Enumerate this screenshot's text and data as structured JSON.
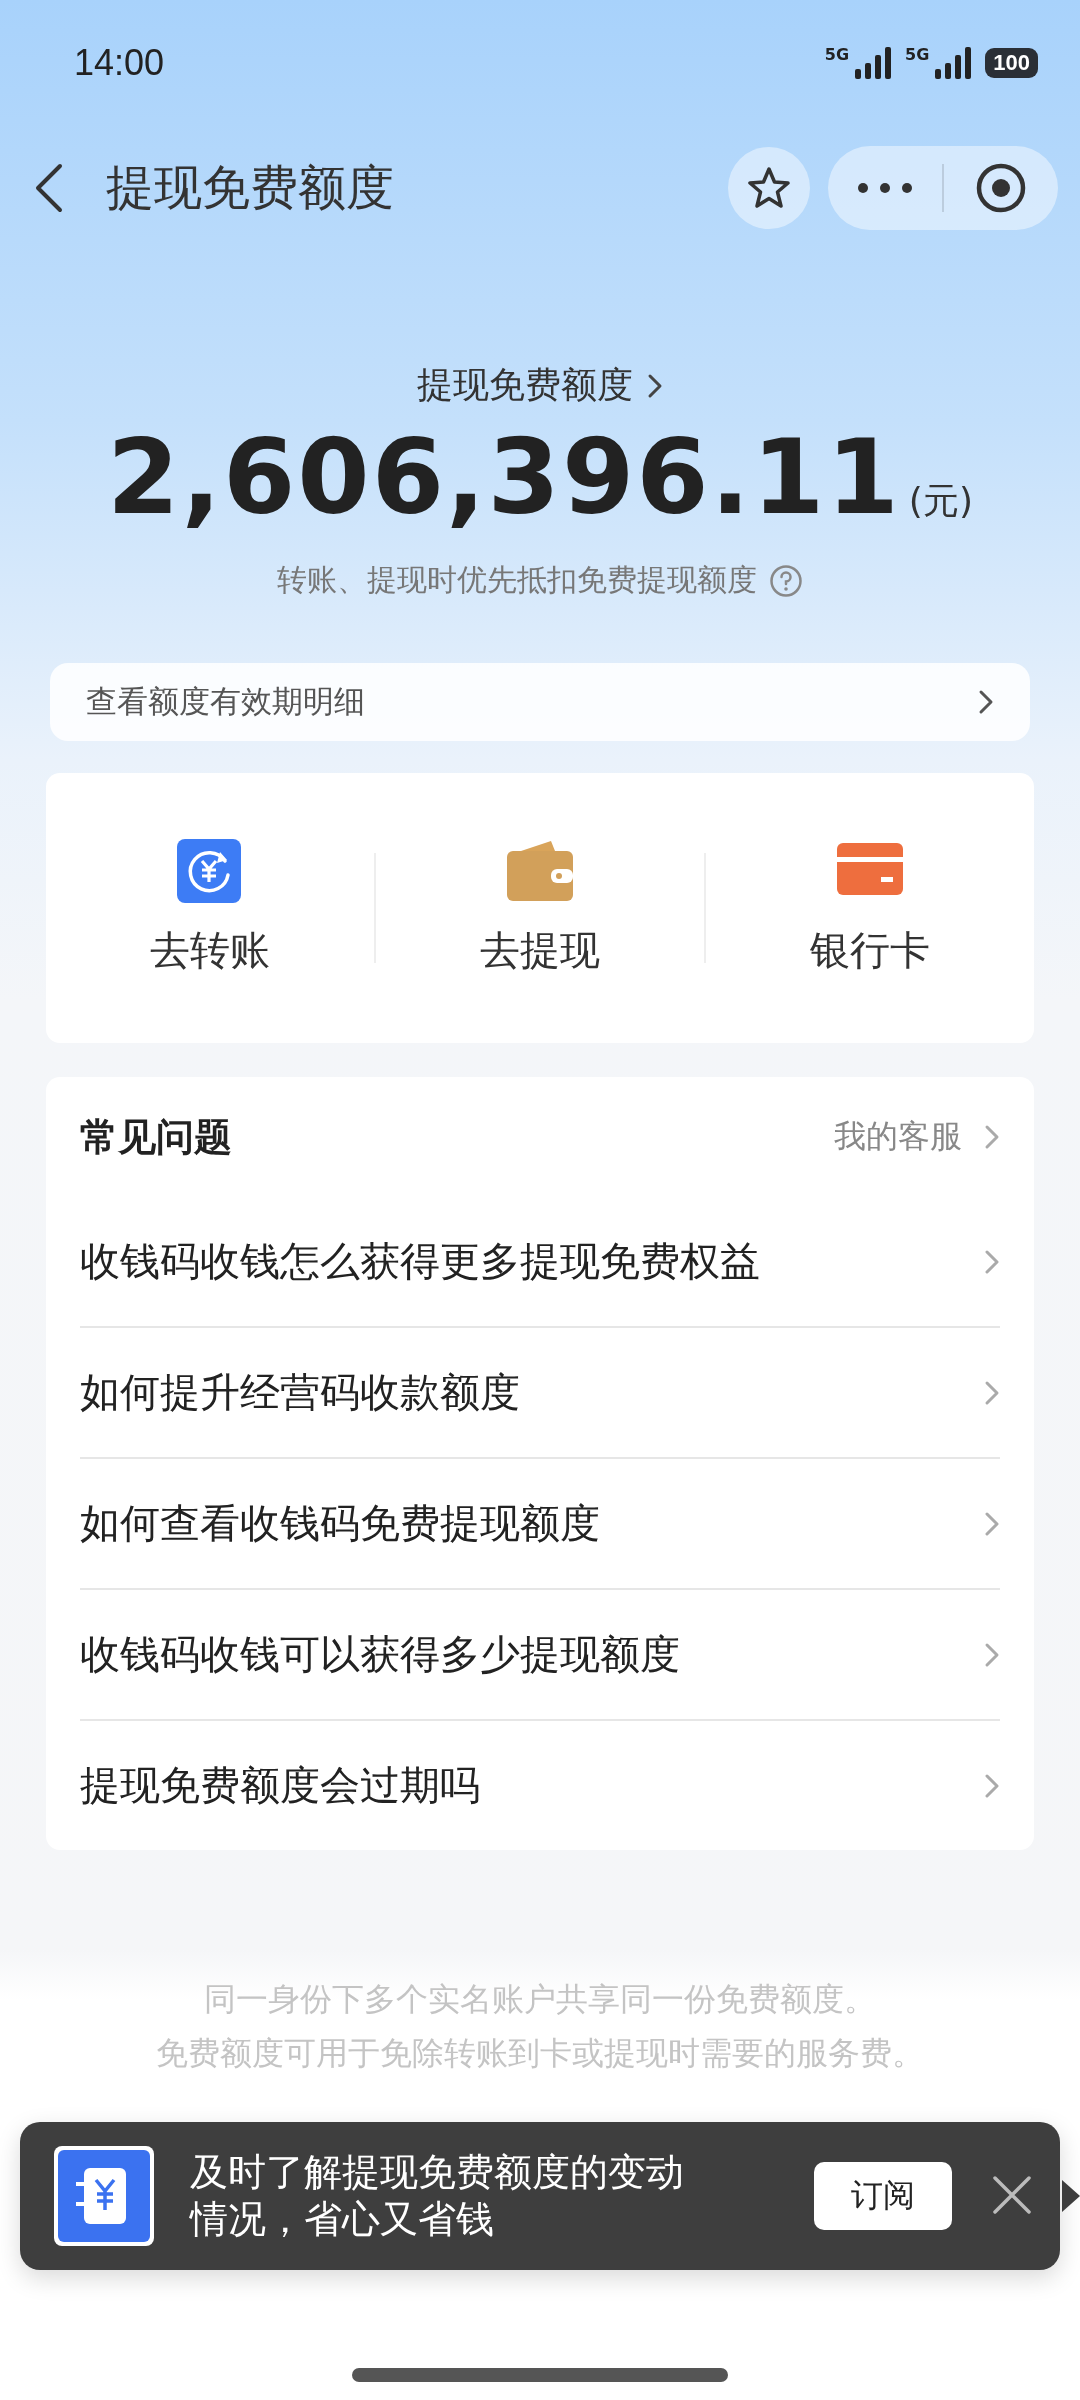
{
  "status_bar": {
    "time": "14:00",
    "networks": [
      "5G",
      "5G"
    ],
    "battery": "100"
  },
  "header": {
    "title": "提现免费额度"
  },
  "summary": {
    "label": "提现免费额度",
    "amount": "2,606,396.11",
    "unit": "(元)",
    "note": "转账、提现时优先抵扣免费提现额度"
  },
  "validity_link": {
    "label": "查看额度有效期明细"
  },
  "actions": [
    {
      "kind": "transfer",
      "label": "去转账"
    },
    {
      "kind": "withdraw",
      "label": "去提现"
    },
    {
      "kind": "card",
      "label": "银行卡"
    }
  ],
  "faq": {
    "title": "常见问题",
    "service_link": "我的客服",
    "items": [
      "收钱码收钱怎么获得更多提现免费权益",
      "如何提升经营码收款额度",
      "如何查看收钱码免费提现额度",
      "收钱码收钱可以获得多少提现额度",
      "提现免费额度会过期吗"
    ]
  },
  "footer_notes": [
    "同一身份下多个实名账户共享同一份免费额度。",
    "免费额度可用于免除转账到卡或提现时需要的服务费。"
  ],
  "subscribe_banner": {
    "message": "及时了解提现免费额度的变动情况，省心又省钱",
    "button": "订阅"
  }
}
